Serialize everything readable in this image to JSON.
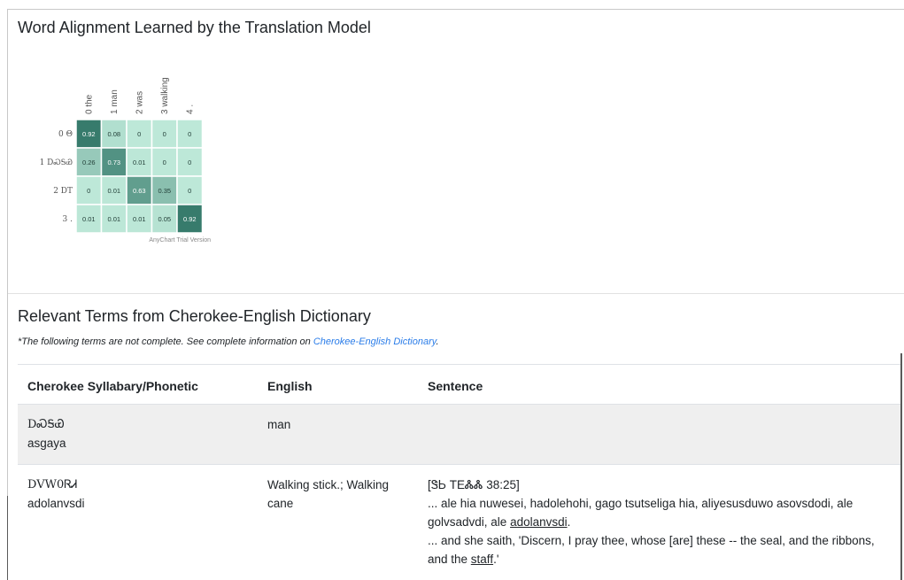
{
  "section1": {
    "title": "Word Alignment Learned by the Translation Model"
  },
  "chart_data": {
    "type": "heatmap",
    "x_labels": [
      "0 the",
      "1 man",
      "2 was",
      "3 walking",
      "4 ."
    ],
    "y_labels": [
      "0 Θ",
      "1 DᏍᎦᏯ",
      "2 DT",
      "3 ."
    ],
    "values": [
      [
        0.92,
        0.08,
        0,
        0,
        0
      ],
      [
        0.26,
        0.73,
        0.01,
        0,
        0
      ],
      [
        0,
        0.01,
        0.63,
        0.35,
        0
      ],
      [
        0.01,
        0.01,
        0.01,
        0.05,
        0.92
      ]
    ],
    "colors": {
      "low": "#bde8d8",
      "high": "#2b7263"
    },
    "watermark": "AnyChart Trial Version"
  },
  "section2": {
    "title": "Relevant Terms from Cherokee-English Dictionary",
    "note_prefix": "*The following terms are not complete. See complete information on ",
    "note_link": "Cherokee-English Dictionary",
    "note_suffix": "."
  },
  "table": {
    "headers": [
      "Cherokee Syllabary/Phonetic",
      "English",
      "Sentence"
    ],
    "rows": [
      {
        "syllabary": "DᏍᎦᏯ",
        "phonetic": "asgaya",
        "english": "man",
        "ref": "",
        "cherokee_pre": "",
        "cherokee_link": "",
        "cherokee_post": "",
        "english_pre": "",
        "english_link": "",
        "english_post": ""
      },
      {
        "syllabary": "DVW0ᏒᏗ",
        "phonetic": "adolanvsdi",
        "english": "Walking stick.; Walking cane",
        "ref": "[ᏕᏏ TEᏜᏜ 38:25]",
        "cherokee_pre": "... ale hia nuwesei, hadolehohi, gago tsutseliga hia, aliyesusduwo asovsdodi, ale golvsadvdi, ale ",
        "cherokee_link": "adolanvsdi",
        "cherokee_post": ".",
        "english_pre": "... and she saith, 'Discern, I pray thee, whose [are] these -- the seal, and the ribbons, and the ",
        "english_link": "staff",
        "english_post": ".'"
      }
    ]
  }
}
